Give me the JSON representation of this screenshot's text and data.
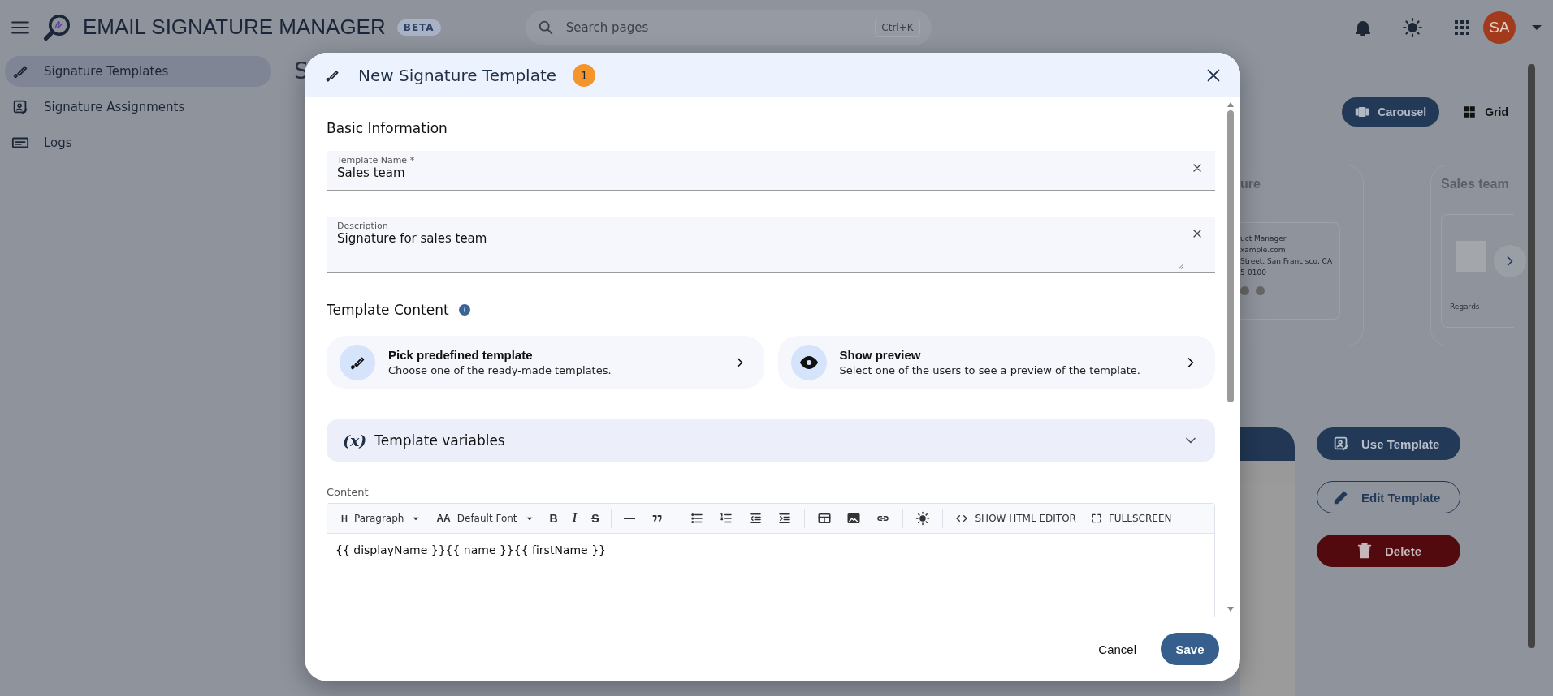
{
  "app_bar": {
    "title": "EMAIL SIGNATURE MANAGER",
    "badge": "BETA",
    "search": {
      "placeholder": "Search pages",
      "shortcut": "Ctrl+K"
    },
    "avatar": "SA"
  },
  "sidebar": {
    "items": [
      {
        "label": "Signature Templates",
        "kind": "templates",
        "selected": true
      },
      {
        "label": "Signature Assignments",
        "kind": "assignments",
        "selected": false
      },
      {
        "label": "Logs",
        "kind": "logs",
        "selected": false
      }
    ]
  },
  "page": {
    "title": "S",
    "view_toggle": [
      {
        "label": "Carousel",
        "kind": "carousel",
        "selected": true
      },
      {
        "label": "Grid",
        "kind": "grid",
        "selected": false
      }
    ],
    "cards": [
      {
        "title": "ure",
        "lines": [
          "uct Manager",
          "xample.com",
          "Street, San Francisco, CA",
          "5-0100"
        ]
      },
      {
        "title": "Sales team",
        "footer": "Regards"
      }
    ],
    "actions": [
      {
        "label": "Use Template",
        "kind": "use"
      },
      {
        "label": "Edit Template",
        "kind": "edit"
      },
      {
        "label": "Delete",
        "kind": "delete"
      }
    ]
  },
  "dialog": {
    "title": "New Signature Template",
    "badge": "1",
    "basic_heading": "Basic Information",
    "fields": [
      {
        "label": "Template Name *",
        "value": "Sales team",
        "kind": "text"
      },
      {
        "label": "Description",
        "value": "Signature for sales team",
        "kind": "textarea"
      }
    ],
    "content_heading": "Template Content",
    "options": [
      {
        "title": "Pick predefined template",
        "description": "Choose one of the ready-made templates.",
        "kind": "brush"
      },
      {
        "title": "Show preview",
        "description": "Select one of the users to see a preview of the template.",
        "kind": "eye"
      }
    ],
    "variables": {
      "symbol": "(x)",
      "label": "Template variables",
      "expanded": false
    },
    "editor": {
      "label": "Content",
      "heading_glyph": "H",
      "block_format": "Paragraph",
      "font_glyph": "AA",
      "font": "Default Font",
      "tools": [
        {
          "kind": "bold",
          "glyph": "B"
        },
        {
          "kind": "italic",
          "glyph": "I"
        },
        {
          "kind": "strike",
          "glyph": "S"
        },
        {
          "kind": "sep"
        },
        {
          "kind": "rule"
        },
        {
          "kind": "quote"
        },
        {
          "kind": "sep"
        },
        {
          "kind": "bullets"
        },
        {
          "kind": "numbers"
        },
        {
          "kind": "outdent"
        },
        {
          "kind": "indent"
        },
        {
          "kind": "sep"
        },
        {
          "kind": "table"
        },
        {
          "kind": "image"
        },
        {
          "kind": "link"
        },
        {
          "kind": "sep"
        },
        {
          "kind": "sun"
        },
        {
          "kind": "sep"
        }
      ],
      "html_button": "SHOW HTML EDITOR",
      "fullscreen_button": "FULLSCREEN",
      "content": "{{ displayName }}{{ name }}{{ firstName }}"
    },
    "buttons": [
      {
        "label": "Cancel",
        "kind": "text"
      },
      {
        "label": "Save",
        "kind": "primary"
      }
    ]
  }
}
